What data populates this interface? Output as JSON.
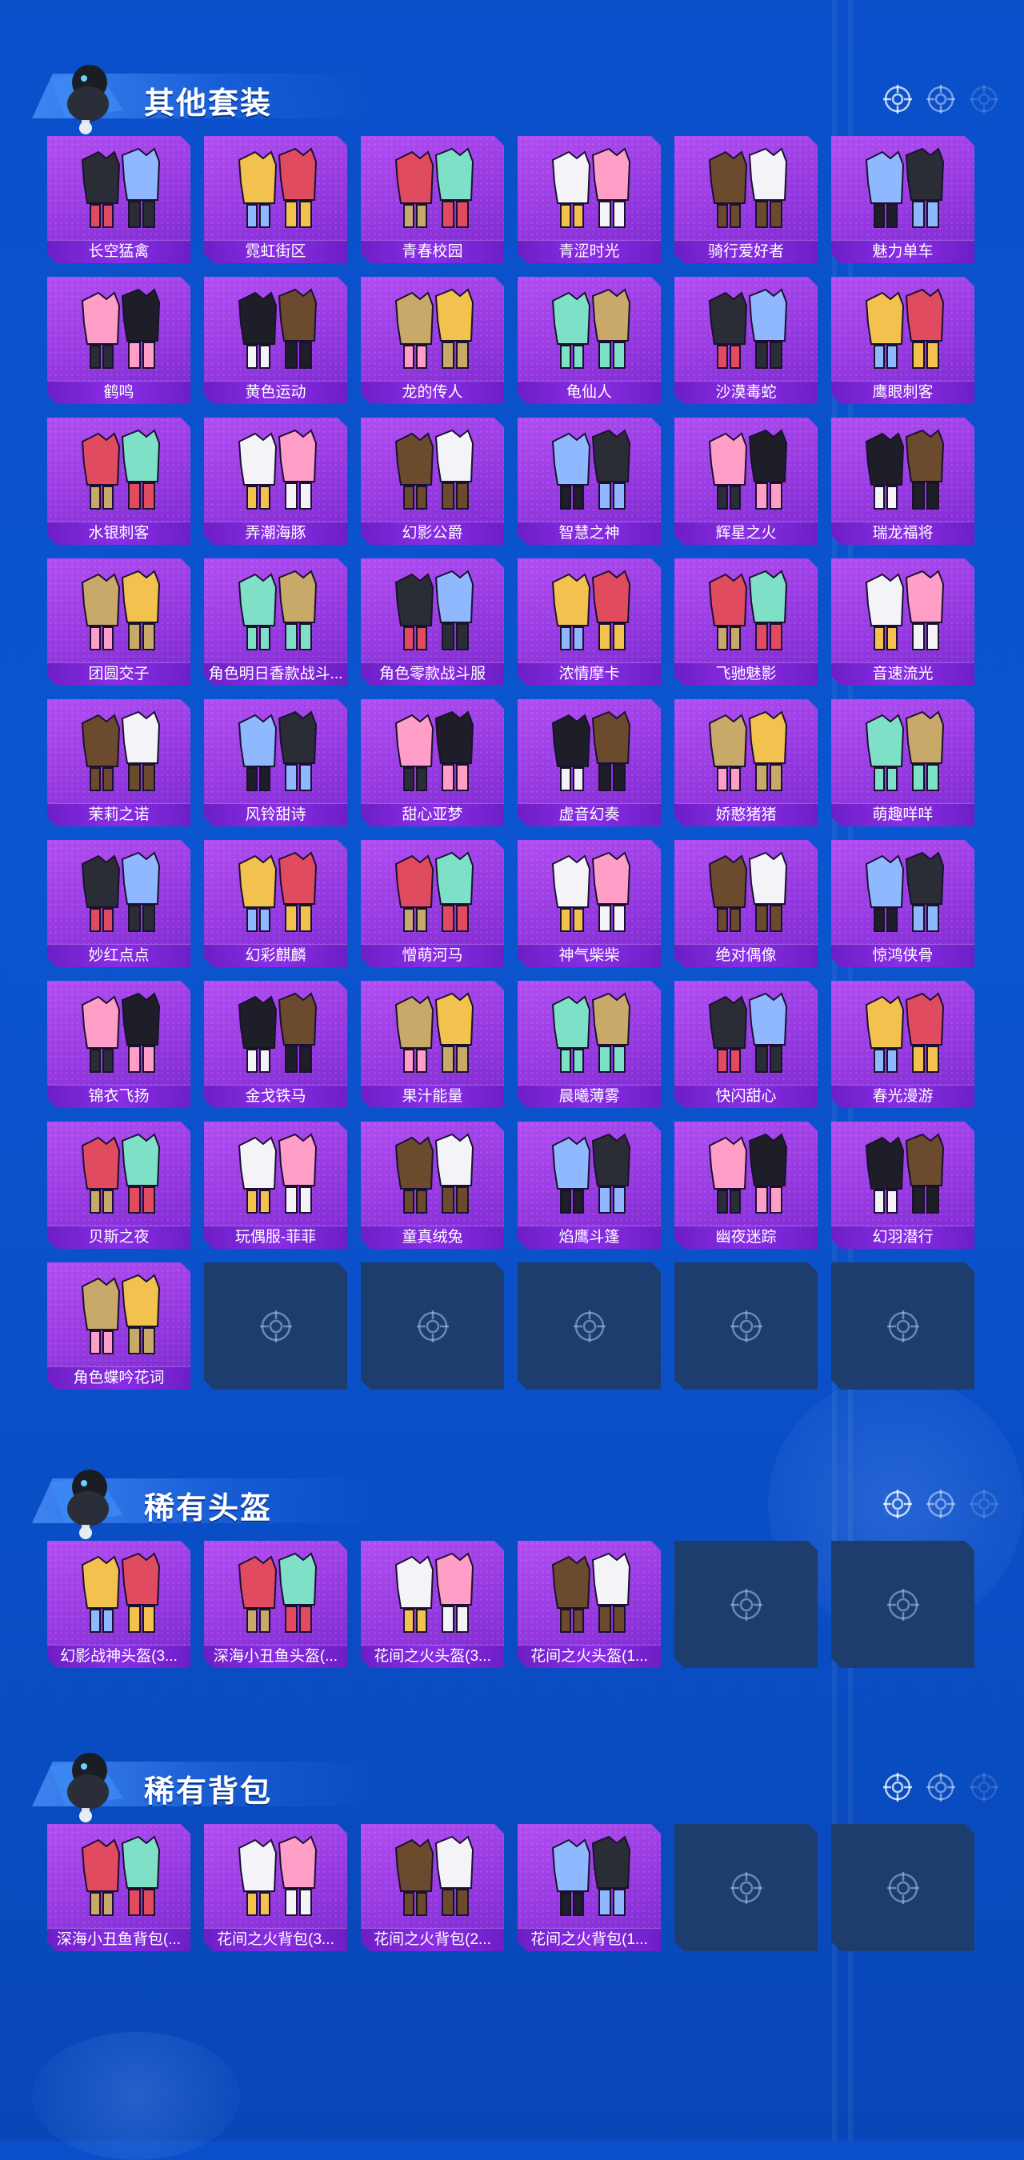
{
  "colors": {
    "background": "#0b55d0",
    "card_purple": "#9a3de3",
    "card_label": "#7a25d6",
    "empty_slot": "#1c3d6e"
  },
  "sections": [
    {
      "title": "其他套装",
      "items": [
        {
          "label": "长空猛禽",
          "icon": "dark-camo-outfit"
        },
        {
          "label": "霓虹街区",
          "icon": "pink-yellow-outfit"
        },
        {
          "label": "青春校园",
          "icon": "school-uniform-outfit"
        },
        {
          "label": "青涩时光",
          "icon": "black-red-outfit"
        },
        {
          "label": "骑行爱好者",
          "icon": "white-jacket-outfit"
        },
        {
          "label": "魅力单车",
          "icon": "yellow-shirt-outfit"
        },
        {
          "label": "鹤鸣",
          "icon": "purple-hoodie-outfit"
        },
        {
          "label": "黄色运动",
          "icon": "yellow-sports-outfit"
        },
        {
          "label": "龙的传人",
          "icon": "red-dress-outfit"
        },
        {
          "label": "龟仙人",
          "icon": "hawaiian-shirt-outfit"
        },
        {
          "label": "沙漠毒蛇",
          "icon": "desert-gear-outfit"
        },
        {
          "label": "鹰眼刺客",
          "icon": "black-hood-outfit"
        },
        {
          "label": "水银刺客",
          "icon": "dark-leather-outfit"
        },
        {
          "label": "弄潮海豚",
          "icon": "street-denim-outfit"
        },
        {
          "label": "幻影公爵",
          "icon": "white-coat-outfit"
        },
        {
          "label": "智慧之神",
          "icon": "purple-robe-outfit"
        },
        {
          "label": "辉星之火",
          "icon": "white-violet-outfit"
        },
        {
          "label": "瑞龙福将",
          "icon": "red-armor-outfit"
        },
        {
          "label": "团圆交子",
          "icon": "red-tang-outfit"
        },
        {
          "label": "角色明日香款战斗...",
          "icon": "red-plugsuit-character"
        },
        {
          "label": "角色零款战斗服",
          "icon": "white-plugsuit-character"
        },
        {
          "label": "浓情摩卡",
          "icon": "gold-orange-outfit"
        },
        {
          "label": "飞驰魅影",
          "icon": "white-gold-outfit"
        },
        {
          "label": "音速流光",
          "icon": "white-tech-outfit"
        },
        {
          "label": "茉莉之诺",
          "icon": "green-white-outfit"
        },
        {
          "label": "风铃甜诗",
          "icon": "white-lace-outfit"
        },
        {
          "label": "甜心亚梦",
          "icon": "black-pink-outfit"
        },
        {
          "label": "虚音幻奏",
          "icon": "plaid-blue-outfit"
        },
        {
          "label": "娇憨猪猪",
          "icon": "pink-pig-outfit"
        },
        {
          "label": "萌趣咩咩",
          "icon": "light-blue-outfit"
        },
        {
          "label": "妙红点点",
          "icon": "red-dot-dress"
        },
        {
          "label": "幻彩麒麟",
          "icon": "pastel-set-outfit"
        },
        {
          "label": "憎萌河马",
          "icon": "mint-onesie-outfit"
        },
        {
          "label": "神气柴柴",
          "icon": "yellow-shiba-outfit"
        },
        {
          "label": "绝对偶像",
          "icon": "idol-stage-outfit"
        },
        {
          "label": "惊鸿侠骨",
          "icon": "dark-red-robe-outfit"
        },
        {
          "label": "锦衣飞扬",
          "icon": "white-robe-outfit"
        },
        {
          "label": "金戈铁马",
          "icon": "black-gold-outfit"
        },
        {
          "label": "果汁能量",
          "icon": "orange-juice-outfit"
        },
        {
          "label": "晨曦薄雾",
          "icon": "mint-dress-outfit"
        },
        {
          "label": "快闪甜心",
          "icon": "black-pink-heart-outfit"
        },
        {
          "label": "春光漫游",
          "icon": "pink-jacket-outfit"
        },
        {
          "label": "贝斯之夜",
          "icon": "bass-night-outfit"
        },
        {
          "label": "玩偶服-菲菲",
          "icon": "doll-suit-character"
        },
        {
          "label": "童真绒兔",
          "icon": "white-bunny-outfit"
        },
        {
          "label": "焰鹰斗篷",
          "icon": "flame-cloak-outfit"
        },
        {
          "label": "幽夜迷踪",
          "icon": "night-cloak-outfit"
        },
        {
          "label": "幻羽潜行",
          "icon": "feather-cloak-outfit"
        },
        {
          "label": "角色蝶吟花词",
          "icon": "butterfly-dress-character"
        }
      ],
      "empty_slots": 5
    },
    {
      "title": "稀有头盔",
      "items": [
        {
          "label": "幻影战神头盔(3...",
          "icon": "phantom-helmet"
        },
        {
          "label": "深海小丑鱼头盔(...",
          "icon": "clownfish-helmet"
        },
        {
          "label": "花间之火头盔(3...",
          "icon": "flower-helmet-3"
        },
        {
          "label": "花间之火头盔(1...",
          "icon": "flower-helmet-1"
        }
      ],
      "empty_slots": 2
    },
    {
      "title": "稀有背包",
      "items": [
        {
          "label": "深海小丑鱼背包(...",
          "icon": "clownfish-backpack"
        },
        {
          "label": "花间之火背包(3...",
          "icon": "flower-backpack-3"
        },
        {
          "label": "花间之火背包(2...",
          "icon": "flower-backpack-2"
        },
        {
          "label": "花间之火背包(1...",
          "icon": "flower-backpack-1"
        }
      ],
      "empty_slots": 2
    }
  ]
}
